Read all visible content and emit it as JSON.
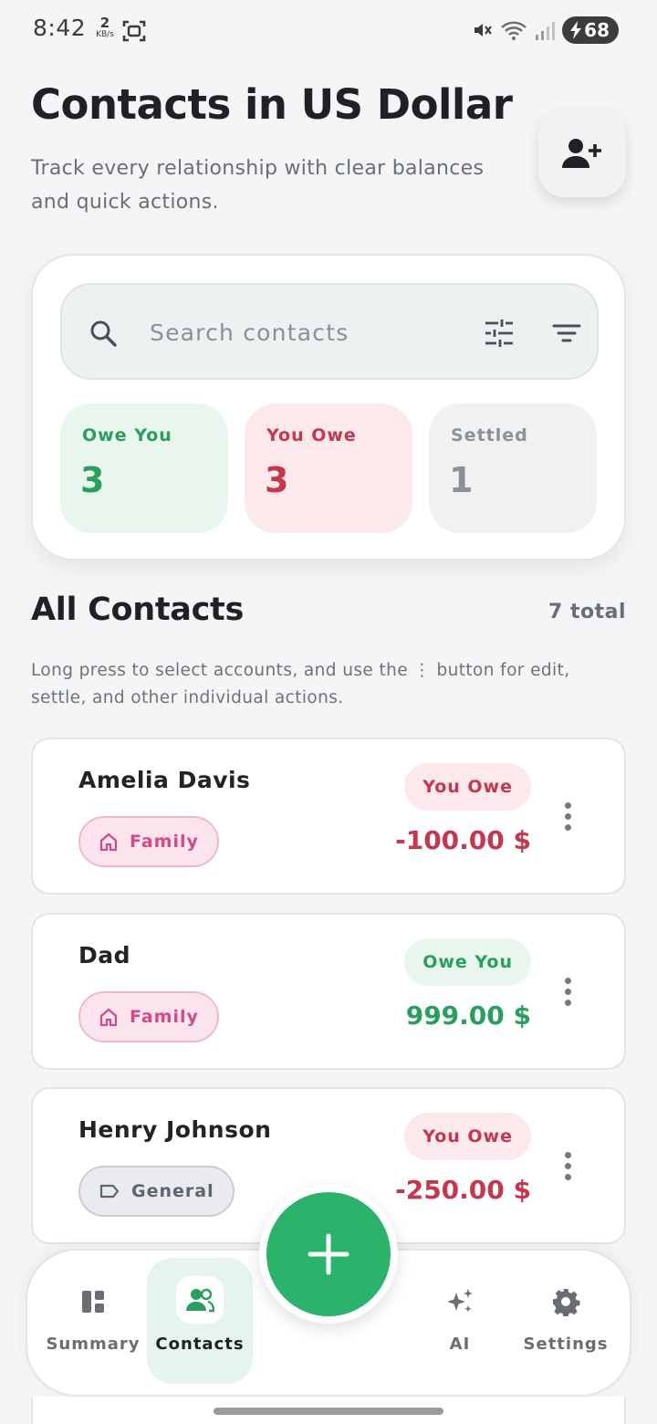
{
  "status_bar": {
    "time": "8:42",
    "net_speed": "2",
    "net_unit": "KB/s",
    "battery": "68"
  },
  "header": {
    "title": "Contacts in US Dollar",
    "subtitle": "Track every relationship with clear balances and quick actions.",
    "add_contact_icon": "person-add-icon"
  },
  "search": {
    "placeholder": "Search contacts",
    "value": ""
  },
  "stats": {
    "owe_you": {
      "label": "Owe You",
      "value": "3"
    },
    "you_owe": {
      "label": "You Owe",
      "value": "3"
    },
    "settled": {
      "label": "Settled",
      "value": "1"
    }
  },
  "list": {
    "title": "All Contacts",
    "count": "7 total",
    "hint": "Long press to select accounts, and use the ⋮ button for edit, settle, and other individual actions."
  },
  "contacts": [
    {
      "name": "Amelia Davis",
      "tag": "Family",
      "status": "You Owe",
      "amount": "-100.00 $"
    },
    {
      "name": "Dad",
      "tag": "Family",
      "status": "Owe You",
      "amount": "999.00 $"
    },
    {
      "name": "Henry Johnson",
      "tag": "General",
      "status": "You Owe",
      "amount": "-250.00 $"
    }
  ],
  "nav": {
    "summary": "Summary",
    "contacts": "Contacts",
    "ai": "AI",
    "settings": "Settings"
  },
  "colors": {
    "accent": "#2ab36a",
    "positive": "#27a05d",
    "negative": "#c7364d",
    "family_tag": "#d04a88"
  }
}
